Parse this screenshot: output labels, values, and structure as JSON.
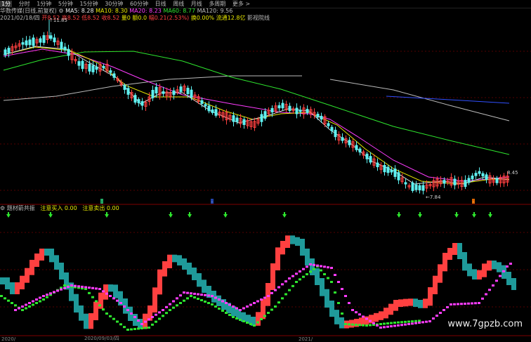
{
  "menu": {
    "items": [
      "1分",
      "分时",
      "1分钟",
      "5分钟",
      "15分钟",
      "30分钟",
      "60分钟",
      "日线",
      "周线",
      "月线",
      "多周期",
      "更多 >"
    ]
  },
  "info": {
    "name": "华数传媒(日线,前复权)",
    "ma5": "MA5: 8.28",
    "ma10": "MA10: 8.30",
    "ma20": "MA20: 8.23",
    "ma60": "MA60: 8.77",
    "ma120": "MA120: 9.56",
    "date": "2021/02/18/四",
    "open": "开8.52",
    "high": "高8.52",
    "low": "低8.52",
    "close": "收8.52",
    "volume": "量0 额0.0",
    "change": "幅0.21(2.53%)",
    "turnover": "换0.00%",
    "float_cap": "流通12.8亿",
    "tags": "影视院线"
  },
  "indicator": {
    "name": "题材箭共振",
    "buy_label": "注意买入",
    "buy_value": "0.00",
    "sell_label": "注意卖出",
    "sell_value": "0.00"
  },
  "tags": {
    "high_price": "11.85",
    "low_price": "7.84",
    "last_price": "8.45"
  },
  "axis": {
    "labels": [
      "2020/",
      "2020/09/03/四",
      "2021/"
    ]
  },
  "watermark": "www.7gpzb.com",
  "colors": {
    "up": "#5ef0f0",
    "down": "#ff4040",
    "ma5": "#dddddd",
    "ma10": "#e8e800",
    "ma20": "#ff3cff",
    "ma60": "#2ee62e",
    "ma120": "#bbbbbb",
    "blue_line": "#3050ff"
  }
}
